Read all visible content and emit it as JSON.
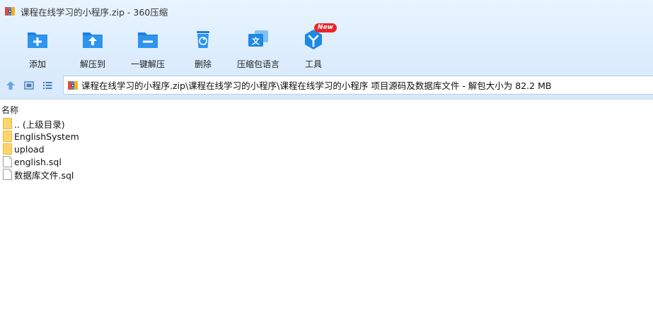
{
  "window": {
    "title": "课程在线学习的小程序.zip - 360压缩"
  },
  "toolbar": {
    "items": [
      {
        "label": "添加",
        "icon": "add-folder-icon"
      },
      {
        "label": "解压到",
        "icon": "extract-to-icon"
      },
      {
        "label": "一键解压",
        "icon": "one-click-extract-icon"
      },
      {
        "label": "删除",
        "icon": "delete-trash-icon"
      },
      {
        "label": "压缩包语言",
        "icon": "archive-language-icon"
      },
      {
        "label": "工具",
        "icon": "tools-icon",
        "badge": "New"
      }
    ]
  },
  "navigation": {
    "up_icon": "up-arrow-icon",
    "view_icon": "thumbnail-view-icon",
    "list_icon": "list-view-icon"
  },
  "address": {
    "path": "课程在线学习的小程序.zip\\课程在线学习的小程序\\课程在线学习的小程序 项目源码及数据库文件 - 解包大小为 82.2 MB"
  },
  "file_list": {
    "column_name": "名称",
    "rows": [
      {
        "name": ".. (上级目录)",
        "type": "folder"
      },
      {
        "name": "EnglishSystem",
        "type": "folder"
      },
      {
        "name": "upload",
        "type": "folder"
      },
      {
        "name": "english.sql",
        "type": "file"
      },
      {
        "name": "数据库文件.sql",
        "type": "file"
      }
    ]
  },
  "colors": {
    "accent": "#1e88e5",
    "chrome_bg": "#dcecfc",
    "folder": "#fdd56c",
    "badge": "#e8262d"
  }
}
